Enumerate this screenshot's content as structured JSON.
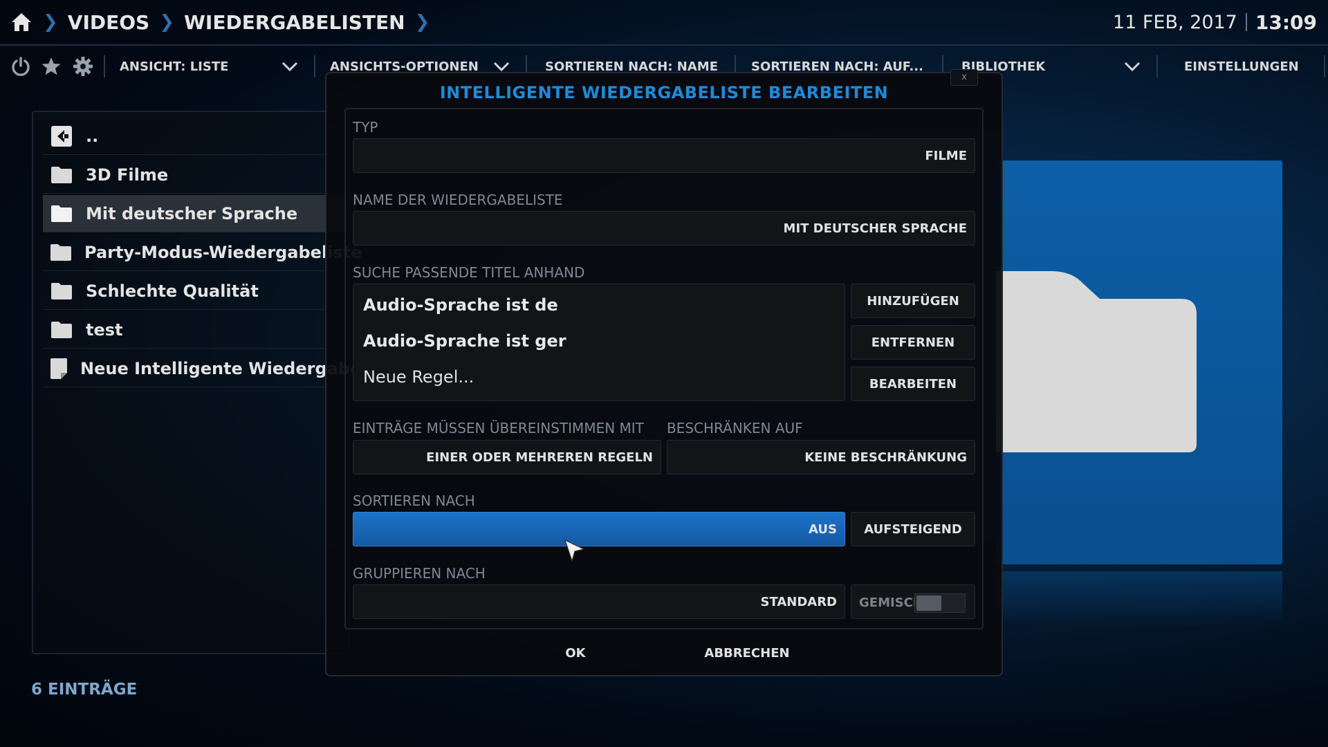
{
  "breadcrumb": {
    "items": [
      "VIDEOS",
      "WIEDERGABELISTEN"
    ]
  },
  "clock": {
    "date": "11 FEB, 2017",
    "time": "13:09"
  },
  "toolbar": {
    "view": "ANSICHT: LISTE",
    "view_options": "ANSICHTS-OPTIONEN",
    "sort_by": "SORTIEREN NACH: NAME",
    "sort_dir": "SORTIEREN NACH: AUF...",
    "library": "BIBLIOTHEK",
    "settings": "EINSTELLUNGEN"
  },
  "list": {
    "items": [
      {
        "label": "..",
        "icon": "back-icon"
      },
      {
        "label": "3D Filme",
        "icon": "folder-icon"
      },
      {
        "label": "Mit deutscher Sprache",
        "icon": "folder-icon"
      },
      {
        "label": "Party-Modus-Wiedergabeliste",
        "icon": "folder-icon"
      },
      {
        "label": "Schlechte Qualität",
        "icon": "folder-icon"
      },
      {
        "label": "test",
        "icon": "folder-icon"
      },
      {
        "label": "Neue Intelligente Wiedergabeliste",
        "icon": "file-icon"
      }
    ],
    "selected_index": 2,
    "count": "6 EINTRÄGE"
  },
  "dialog": {
    "title": "INTELLIGENTE WIEDERGABELISTE BEARBEITEN",
    "close": "x",
    "type_label": "TYP",
    "type_value": "FILME",
    "name_label": "NAME DER WIEDERGABELISTE",
    "name_value": "MIT DEUTSCHER SPRACHE",
    "rules_label": "SUCHE PASSENDE TITEL ANHAND",
    "rules": [
      "Audio-Sprache ist de",
      "Audio-Sprache ist ger",
      "Neue Regel..."
    ],
    "add": "HINZUFÜGEN",
    "remove": "ENTFERNEN",
    "edit": "BEARBEITEN",
    "match_label": "EINTRÄGE MÜSSEN ÜBEREINSTIMMEN MIT",
    "match_value": "EINER ODER MEHREREN REGELN",
    "limit_label": "BESCHRÄNKEN AUF",
    "limit_value": "KEINE BESCHRÄNKUNG",
    "sort_label": "SORTIEREN NACH",
    "sort_value": "AUS",
    "sort_order": "AUFSTEIGEND",
    "group_label": "GRUPPIEREN NACH",
    "group_value": "STANDARD",
    "mixed_label": "GEMISCHT",
    "mixed_on": false,
    "ok": "OK",
    "cancel": "ABBRECHEN"
  },
  "colors": {
    "accent": "#1f8ad8",
    "selected_field": "#1a6bbf"
  }
}
